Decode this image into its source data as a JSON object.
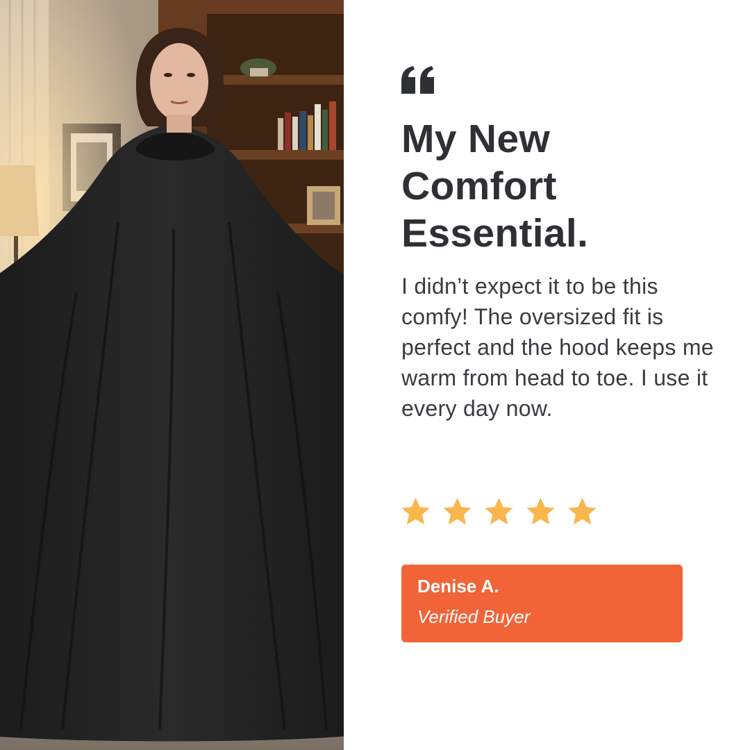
{
  "photo": {
    "subject": "woman wearing black oversized hooded blanket"
  },
  "quote_icon": "quote-mark-icon",
  "headline": "My New\nComfort\nEssential.",
  "review_text": "I didn’t expect it to be this comfy! The oversized fit is perfect and the hood keeps me warm from head to toe. I use it every day now.",
  "rating": {
    "value": 5,
    "max": 5,
    "icon": "star-icon",
    "color": "#f8b64c"
  },
  "reviewer": {
    "name": "Denise A.",
    "status": "Verified Buyer"
  },
  "colors": {
    "accent": "#f06438",
    "headline": "#2f3035",
    "body_text": "#3a3b40"
  }
}
